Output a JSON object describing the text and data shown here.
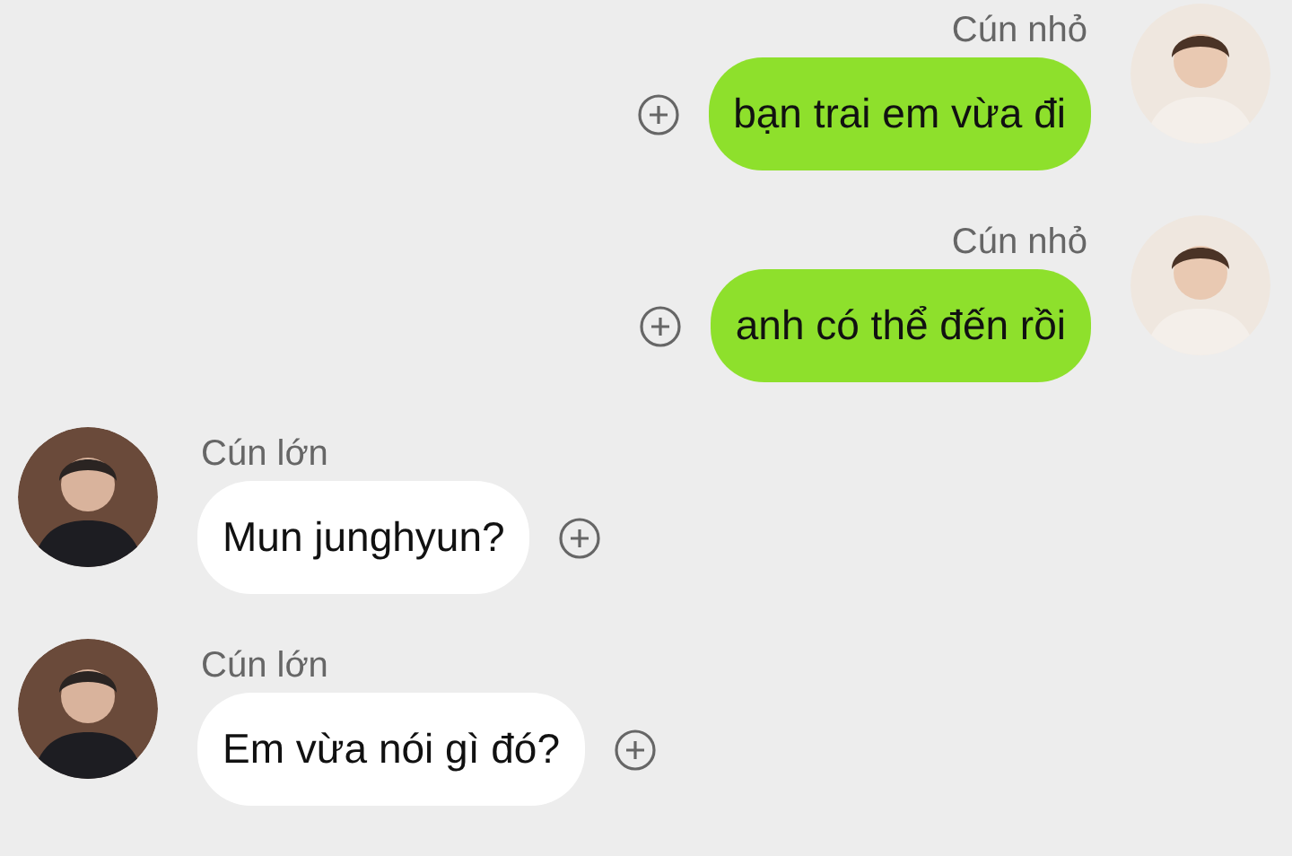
{
  "messages": [
    {
      "kind": "sent",
      "sender": "Cún nhỏ",
      "text": "bạn trai em vừa đi"
    },
    {
      "kind": "sent",
      "sender": "Cún nhỏ",
      "text": "anh có thể đến rồi"
    },
    {
      "kind": "received",
      "sender": "Cún lớn",
      "text": "Mun junghyun?"
    },
    {
      "kind": "received",
      "sender": "Cún lớn",
      "text": "Em vừa nói gì đó?"
    }
  ]
}
